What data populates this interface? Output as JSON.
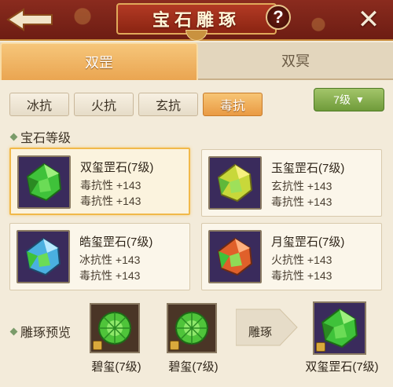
{
  "header": {
    "title": "宝石雕琢",
    "help": "?",
    "close": "✕"
  },
  "main_tabs": [
    {
      "label": "双罡",
      "active": true
    },
    {
      "label": "双冥",
      "active": false
    }
  ],
  "sub_tabs": [
    {
      "label": "冰抗",
      "active": false
    },
    {
      "label": "火抗",
      "active": false
    },
    {
      "label": "玄抗",
      "active": false
    },
    {
      "label": "毒抗",
      "active": true
    }
  ],
  "level_select": {
    "value": "7级"
  },
  "section_gem_level": "宝石等级",
  "gems": [
    {
      "name": "双玺罡石(7级)",
      "stat1": "毒抗性 +143",
      "stat2": "毒抗性 +143",
      "color": "#3fc23a",
      "selected": true
    },
    {
      "name": "玉玺罡石(7级)",
      "stat1": "玄抗性 +143",
      "stat2": "毒抗性 +143",
      "color": "#e8d63a",
      "selected": false
    },
    {
      "name": "皓玺罡石(7级)",
      "stat1": "冰抗性 +143",
      "stat2": "毒抗性 +143",
      "color": "#4ab0e0",
      "selected": false
    },
    {
      "name": "月玺罡石(7级)",
      "stat1": "火抗性 +143",
      "stat2": "毒抗性 +143",
      "color": "#e0602a",
      "selected": false
    }
  ],
  "preview": {
    "label": "雕琢预览",
    "slot1": "碧玺(7级)",
    "slot2": "碧玺(7级)",
    "action": "雕琢",
    "result": "双玺罡石(7级)"
  }
}
